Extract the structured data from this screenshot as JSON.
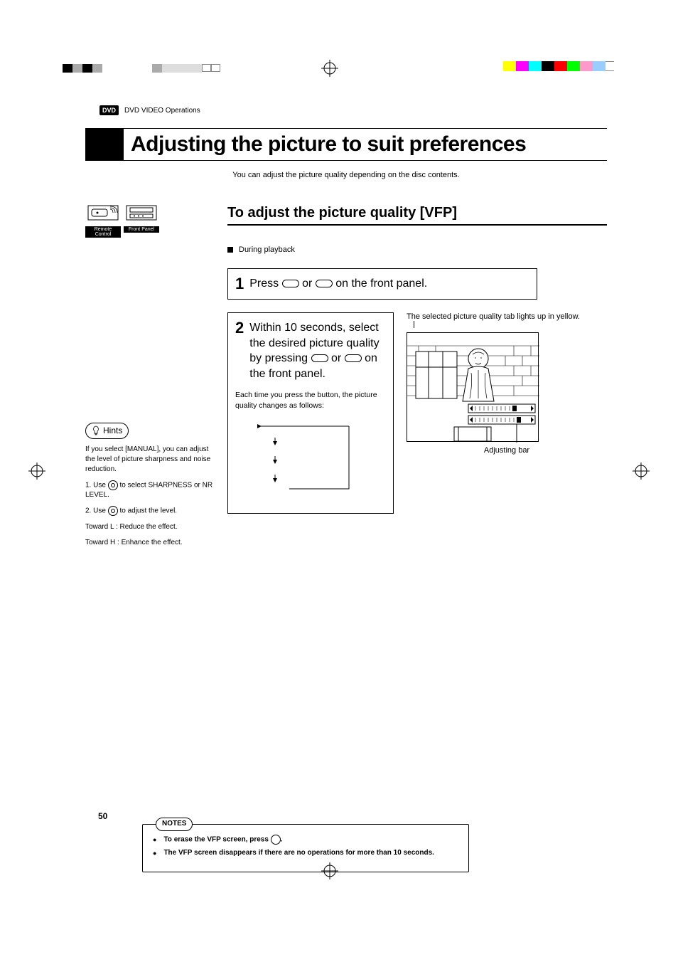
{
  "header": {
    "badge": "DVD",
    "section": "DVD VIDEO Operations"
  },
  "title": "Adjusting the picture to suit preferences",
  "intro": "You can adjust the picture quality depending on the disc contents.",
  "icons": {
    "remote_label": "Remote Control",
    "front_label": "Front Panel"
  },
  "subtitle": "To adjust the picture quality [VFP]",
  "during": "During playback",
  "step1": {
    "num": "1",
    "pre": "Press",
    "mid": "or",
    "post": "on the front panel."
  },
  "step2": {
    "num": "2",
    "line1": "Within 10 seconds, select the desired picture quality by pressing",
    "mid": "or",
    "post": "on the front panel.",
    "desc": "Each time you press the button, the picture quality changes as follows:",
    "right_intro": "The selected picture quality tab lights up in yellow.",
    "adjusting_label": "Adjusting bar"
  },
  "hints": {
    "label": "Hints",
    "p1": "If you select [MANUAL], you can adjust the level of picture sharpness and noise reduction.",
    "s1a": "1. Use",
    "s1b": "to select SHARPNESS or NR LEVEL.",
    "s2a": "2. Use",
    "s2b": "to adjust the level.",
    "p3": "Toward L : Reduce the effect.",
    "p4": "Toward H : Enhance the effect."
  },
  "notes": {
    "label": "NOTES",
    "n1a": "To erase the VFP screen, press",
    "n1b": ".",
    "n2": "The VFP screen disappears if there are no operations for more than 10 seconds."
  },
  "page_number": "50"
}
